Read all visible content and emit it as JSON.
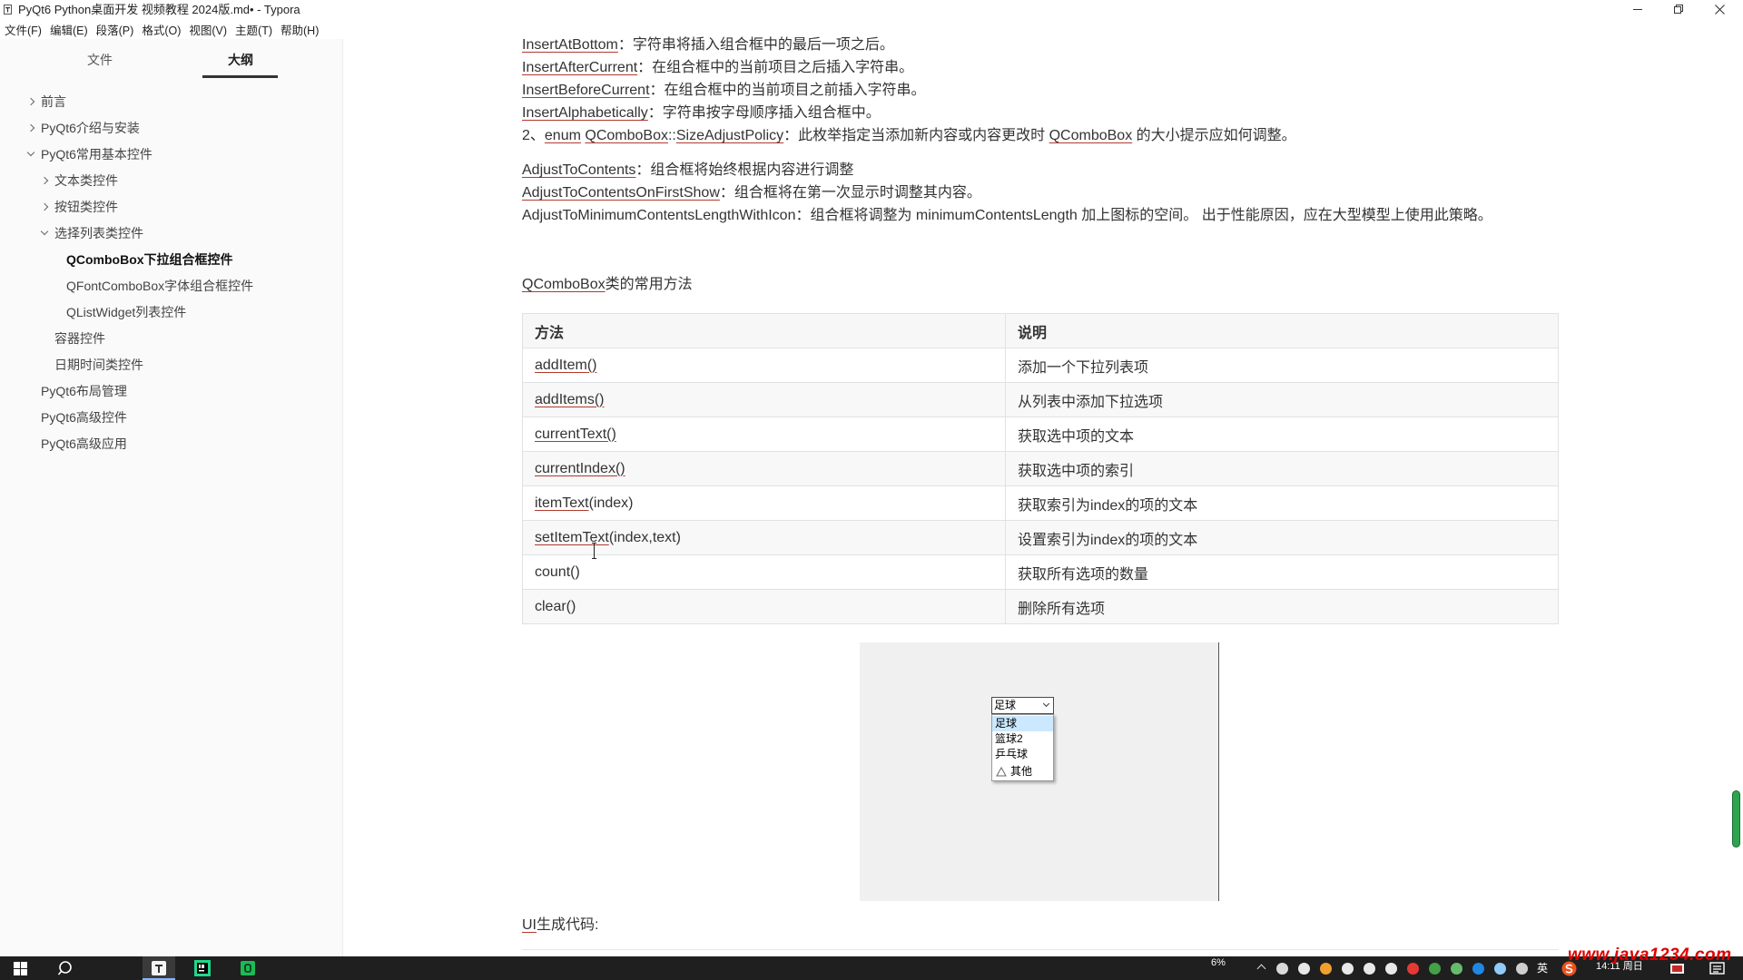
{
  "window": {
    "title": "PyQt6 Python桌面开发 视频教程 2024版.md• - Typora",
    "app_icon": "typora-icon",
    "controls": [
      "minimize-icon",
      "restore-icon",
      "close-icon"
    ]
  },
  "menu": [
    "文件(F)",
    "编辑(E)",
    "段落(P)",
    "格式(O)",
    "视图(V)",
    "主题(T)",
    "帮助(H)"
  ],
  "sidebar": {
    "tabs": [
      {
        "label": "文件",
        "active": false
      },
      {
        "label": "大纲",
        "active": true
      }
    ],
    "outline": [
      {
        "label": "前言",
        "level": 1,
        "icon": "chevron-right-icon"
      },
      {
        "label": "PyQt6介绍与安装",
        "level": 1,
        "icon": "chevron-right-icon"
      },
      {
        "label": "PyQt6常用基本控件",
        "level": 1,
        "icon": "chevron-down-icon"
      },
      {
        "label": "文本类控件",
        "level": 2,
        "icon": "chevron-right-icon"
      },
      {
        "label": "按钮类控件",
        "level": 2,
        "icon": "chevron-right-icon"
      },
      {
        "label": "选择列表类控件",
        "level": 2,
        "icon": "chevron-down-icon"
      },
      {
        "label": "QComboBox下拉组合框控件",
        "level": 3,
        "icon": "",
        "active": true
      },
      {
        "label": "QFontComboBox字体组合框控件",
        "level": 3,
        "icon": ""
      },
      {
        "label": "QListWidget列表控件",
        "level": 3,
        "icon": ""
      },
      {
        "label": "容器控件",
        "level": 2,
        "icon": ""
      },
      {
        "label": "日期时间类控件",
        "level": 2,
        "icon": ""
      },
      {
        "label": "PyQt6布局管理",
        "level": 1,
        "icon": ""
      },
      {
        "label": "PyQt6高级控件",
        "level": 1,
        "icon": ""
      },
      {
        "label": "PyQt6高级应用",
        "level": 1,
        "icon": ""
      }
    ]
  },
  "content": {
    "block1": [
      [
        {
          "t": "InsertAtBottom",
          "u": true
        },
        {
          "t": "：字符串将插入组合框中的最后一项之后。"
        }
      ],
      [
        {
          "t": "InsertAfterCurrent",
          "u": true
        },
        {
          "t": "：在组合框中的当前项目之后插入字符串。"
        }
      ],
      [
        {
          "t": "InsertBeforeCurrent",
          "u": true
        },
        {
          "t": "：在组合框中的当前项目之前插入字符串。"
        }
      ],
      [
        {
          "t": "InsertAlphabetically",
          "u": true
        },
        {
          "t": "：字符串按字母顺序插入组合框中。"
        }
      ],
      [
        {
          "t": "2、"
        },
        {
          "t": "enum",
          "u": true
        },
        {
          "t": " "
        },
        {
          "t": "QComboBox",
          "u": true
        },
        {
          "t": "::"
        },
        {
          "t": "SizeAdjustPolicy",
          "u": true
        },
        {
          "t": "：此枚举指定当添加新内容或内容更改时 "
        },
        {
          "t": "QComboBox",
          "u": true
        },
        {
          "t": " 的大小提示应如何调整。"
        }
      ]
    ],
    "block2": [
      [
        {
          "t": "AdjustToContents",
          "u": true
        },
        {
          "t": "：组合框将始终根据内容进行调整"
        }
      ],
      [
        {
          "t": "AdjustToContentsOnFirstShow",
          "u": true
        },
        {
          "t": "：组合框将在第一次显示时调整其内容。"
        }
      ],
      [
        {
          "t": "AdjustToMinimumContentsLengthWithIcon"
        },
        {
          "t": "：组合框将调整为 minimumContentsLength 加上图标的空间。 出于性能原因，应在大型模型上使用此策略。"
        }
      ]
    ],
    "heading": [
      {
        "t": "QComboBox",
        "u": true
      },
      {
        "t": "类的常用方法"
      }
    ],
    "table": {
      "headers": [
        "方法",
        "说明"
      ],
      "rows": [
        {
          "method": [
            {
              "t": "addItem()",
              "u": true
            }
          ],
          "desc": "添加一个下拉列表项"
        },
        {
          "method": [
            {
              "t": "addItems()",
              "u": true
            }
          ],
          "desc": "从列表中添加下拉选项"
        },
        {
          "method": [
            {
              "t": "currentText()",
              "u": true
            }
          ],
          "desc": "获取选中项的文本"
        },
        {
          "method": [
            {
              "t": "currentIndex()",
              "u": true
            }
          ],
          "desc": "获取选中项的索引"
        },
        {
          "method": [
            {
              "t": "itemText",
              "u": true
            },
            {
              "t": "(index)"
            }
          ],
          "desc": "获取索引为index的项的文本"
        },
        {
          "method": [
            {
              "t": "setItemText",
              "u": true
            },
            {
              "t": "(index,text)"
            }
          ],
          "desc": "设置索引为index的项的文本"
        },
        {
          "method": [
            {
              "t": "count()"
            }
          ],
          "desc": "获取所有选项的数量"
        },
        {
          "method": [
            {
              "t": "clear()"
            }
          ],
          "desc": "删除所有选项"
        }
      ]
    },
    "preview": {
      "combo_value": "足球",
      "items": [
        {
          "label": "足球",
          "selected": true
        },
        {
          "label": "篮球2"
        },
        {
          "label": "乒乓球"
        },
        {
          "label": "其他",
          "icon": "triangle-icon"
        }
      ]
    },
    "code_label": [
      {
        "t": "UI",
        "u": true
      },
      {
        "t": "生成代码:"
      }
    ]
  },
  "taskbar": {
    "pinned": [
      "windows-start-icon",
      "search-icon",
      "typora-app-icon",
      "pycharm-app-icon",
      "green-app-icon"
    ],
    "cpu": "6%",
    "tray": [
      {
        "icon": "microphone-icon",
        "color": "#d9d9d9"
      },
      {
        "icon": "qq-icon",
        "color": "#e8e8e8"
      },
      {
        "icon": "qq-icon",
        "color": "#f0a030"
      },
      {
        "icon": "qq-icon",
        "color": "#e8e8e8"
      },
      {
        "icon": "qq-icon",
        "color": "#e8e8e8"
      },
      {
        "icon": "qq-icon",
        "color": "#e8e8e8"
      },
      {
        "icon": "red-app-icon",
        "color": "#e53935"
      },
      {
        "icon": "green-app-icon",
        "color": "#43a047"
      },
      {
        "icon": "wechat-icon",
        "color": "#66bb6a"
      },
      {
        "icon": "blue-app-icon",
        "color": "#1e88e5"
      },
      {
        "icon": "network-icon",
        "color": "#90caf9"
      },
      {
        "icon": "display-icon",
        "color": "#cfcfcf"
      }
    ],
    "ime": "英",
    "clock": "14:11 周日"
  },
  "watermark": "www.java1234.com",
  "colors": {
    "underline": "#b03a2e",
    "scrollbar": "#2ea44f",
    "taskbar": "#1f1f1f",
    "watermark": "#e00000",
    "selected_item": "#cce8ff"
  }
}
